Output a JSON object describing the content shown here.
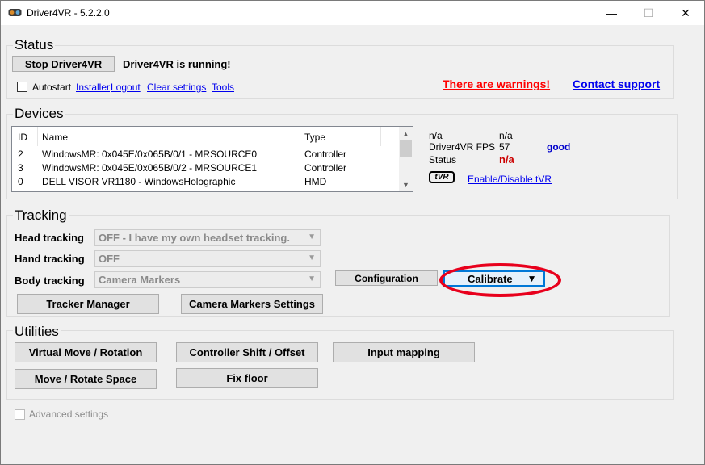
{
  "window": {
    "title": "Driver4VR - 5.2.2.0",
    "min": "—",
    "max": "☐",
    "close": "✕"
  },
  "status": {
    "heading": "Status",
    "stop_button": "Stop Driver4VR",
    "running_text": "Driver4VR is running!",
    "autostart_label": "Autostart",
    "links": [
      "Installer",
      "Logout",
      "Clear settings",
      "Tools"
    ],
    "warnings_link": "There are warnings!",
    "support_link": "Contact support",
    "warning_color": "#ff0000",
    "link_color": "#0000ee"
  },
  "devices": {
    "heading": "Devices",
    "columns": [
      "ID",
      "Name",
      "Type"
    ],
    "rows": [
      {
        "id": "2",
        "name": "WindowsMR: 0x045E/0x065B/0/1 - MRSOURCE0",
        "type": "Controller"
      },
      {
        "id": "3",
        "name": "WindowsMR: 0x045E/0x065B/0/2 - MRSOURCE1",
        "type": "Controller"
      },
      {
        "id": "0",
        "name": "DELL VISOR VR1180 - WindowsHolographic",
        "type": "HMD"
      }
    ],
    "info": {
      "r1c1": "n/a",
      "r1c2": "n/a",
      "fps_label": "Driver4VR FPS",
      "fps_value": "57",
      "fps_quality": "good",
      "status_label": "Status",
      "status_value": "n/a"
    },
    "tvr_logo": "tVR",
    "tvr_link": "Enable/Disable tVR"
  },
  "tracking": {
    "heading": "Tracking",
    "head_label": "Head tracking",
    "head_value": "OFF - I have my own headset tracking.",
    "hand_label": "Hand tracking",
    "hand_value": "OFF",
    "body_label": "Body tracking",
    "body_value": "Camera Markers",
    "config_button": "Configuration",
    "calibrate_button": "Calibrate",
    "calibrate_arrow": "▼",
    "tracker_manager_button": "Tracker Manager",
    "camera_markers_button": "Camera Markers Settings"
  },
  "utilities": {
    "heading": "Utilities",
    "virtual_move": "Virtual Move / Rotation",
    "controller_shift": "Controller Shift / Offset",
    "input_mapping": "Input mapping",
    "move_rotate_space": "Move / Rotate Space",
    "fix_floor": "Fix floor"
  },
  "advanced": {
    "label": "Advanced settings"
  }
}
